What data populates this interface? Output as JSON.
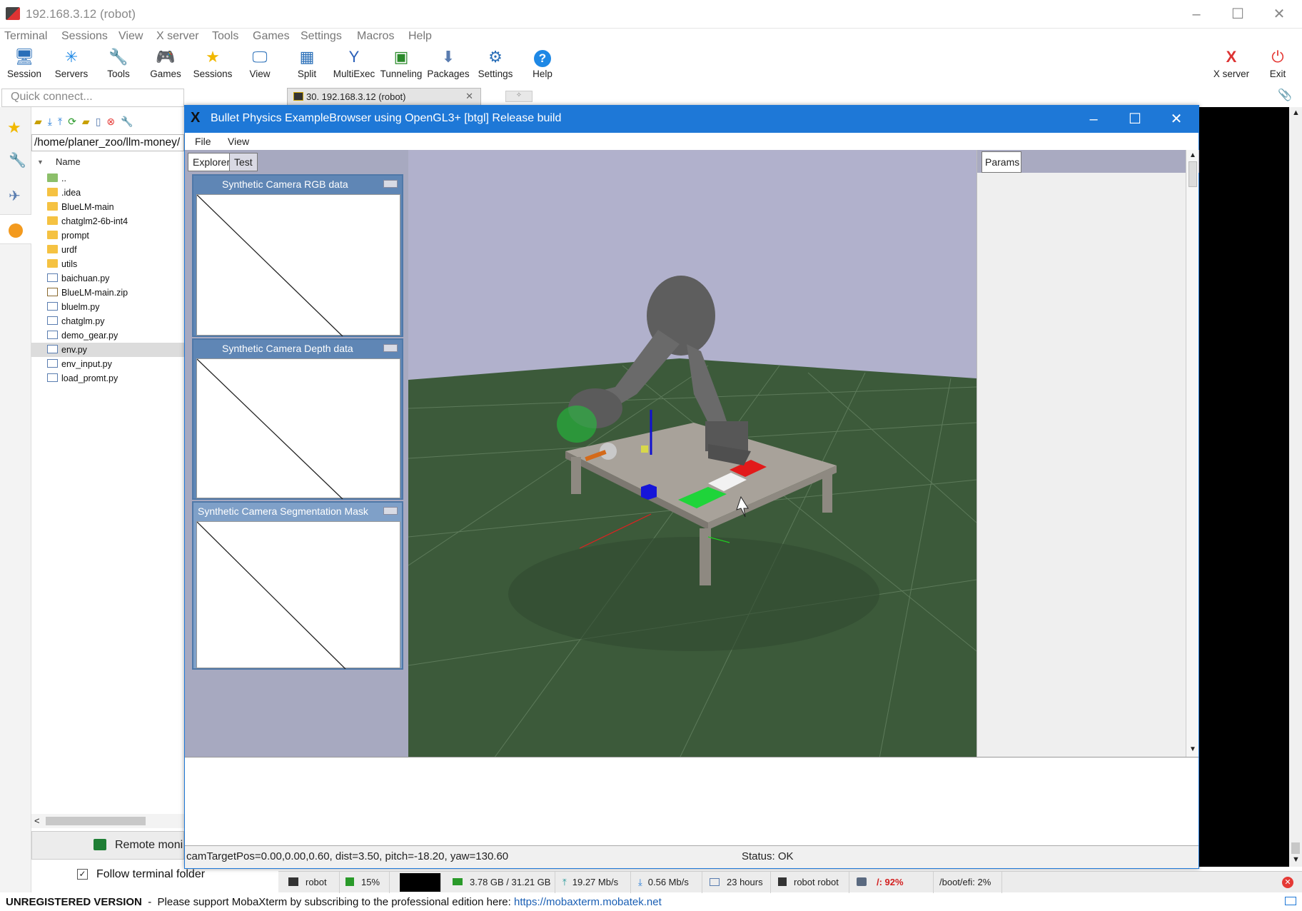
{
  "window": {
    "title": "192.168.3.12 (robot)"
  },
  "menu": [
    "Terminal",
    "Sessions",
    "View",
    "X server",
    "Tools",
    "Games",
    "Settings",
    "Macros",
    "Help"
  ],
  "toolbar": [
    {
      "label": "Session",
      "icon": "session-icon"
    },
    {
      "label": "Servers",
      "icon": "servers-icon"
    },
    {
      "label": "Tools",
      "icon": "tools-icon"
    },
    {
      "label": "Games",
      "icon": "games-icon"
    },
    {
      "label": "Sessions",
      "icon": "sessions-star-icon"
    },
    {
      "label": "View",
      "icon": "view-icon"
    },
    {
      "label": "Split",
      "icon": "split-icon"
    },
    {
      "label": "MultiExec",
      "icon": "multiexec-icon"
    },
    {
      "label": "Tunneling",
      "icon": "tunneling-icon"
    },
    {
      "label": "Packages",
      "icon": "packages-icon"
    },
    {
      "label": "Settings",
      "icon": "settings-icon"
    },
    {
      "label": "Help",
      "icon": "help-icon"
    }
  ],
  "toolbar_right": [
    {
      "label": "X server"
    },
    {
      "label": "Exit"
    }
  ],
  "quick_connect": {
    "placeholder": "Quick connect..."
  },
  "tab": {
    "label": "30. 192.168.3.12 (robot)"
  },
  "sftp": {
    "path": "/home/planer_zoo/llm-money/",
    "column": "Name",
    "files": [
      {
        "name": "..",
        "type": "up"
      },
      {
        "name": ".idea",
        "type": "folder"
      },
      {
        "name": "BlueLM-main",
        "type": "folder"
      },
      {
        "name": "chatglm2-6b-int4",
        "type": "folder"
      },
      {
        "name": "prompt",
        "type": "folder"
      },
      {
        "name": "urdf",
        "type": "folder"
      },
      {
        "name": "utils",
        "type": "folder"
      },
      {
        "name": "baichuan.py",
        "type": "py"
      },
      {
        "name": "BlueLM-main.zip",
        "type": "zip"
      },
      {
        "name": "bluelm.py",
        "type": "py"
      },
      {
        "name": "chatglm.py",
        "type": "py"
      },
      {
        "name": "demo_gear.py",
        "type": "py"
      },
      {
        "name": "env.py",
        "type": "py",
        "selected": true
      },
      {
        "name": "env_input.py",
        "type": "py"
      },
      {
        "name": "load_promt.py",
        "type": "py"
      }
    ],
    "remote_monitoring": "Remote moni",
    "follow_terminal": "Follow terminal folder"
  },
  "bullet": {
    "title": "Bullet Physics ExampleBrowser using OpenGL3+ [btgl] Release build",
    "menu": [
      "File",
      "View"
    ],
    "tabs": [
      "Explorer",
      "Test"
    ],
    "panels": [
      "Synthetic Camera RGB data",
      "Synthetic Camera Depth data",
      "Synthetic Camera Segmentation Mask"
    ],
    "params_tab": "Params",
    "status_left": "camTargetPos=0.00,0.00,0.60, dist=3.50, pitch=-18.20, yaw=130.60",
    "status_right": "Status: OK"
  },
  "statusbar": {
    "user": "robot",
    "cpu": "15%",
    "mem": "3.78 GB / 31.21 GB",
    "upload": "19.27 Mb/s",
    "download": "0.56 Mb/s",
    "uptime": "23 hours",
    "users": "robot  robot",
    "disk_root": "/: 92%",
    "disk_boot": "/boot/efi: 2%"
  },
  "footer": {
    "unregistered": "UNREGISTERED VERSION",
    "message": "  -  Please support MobaXterm by subscribing to the professional edition here: ",
    "link": "https://mobaxterm.mobatek.net"
  },
  "colors": {
    "accent": "#1e78d7",
    "bullet_bg": "#b2b2cb",
    "ground": "#3c5a3a"
  }
}
